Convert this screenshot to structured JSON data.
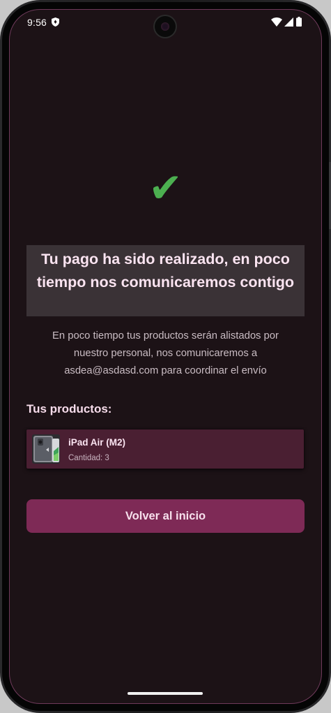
{
  "status_bar": {
    "time": "9:56",
    "icons": [
      "shield-icon",
      "wifi-icon",
      "signal-icon",
      "battery-icon"
    ]
  },
  "confirmation": {
    "check_symbol": "✔",
    "check_color": "#4caf50",
    "headline": "Tu pago ha sido realizado, en poco tiempo nos comunicaremos contigo",
    "description": "En poco tiempo tus productos serán alistados por nuestro personal, nos comunicaremos a asdea@asdasd.com para coordinar el envío"
  },
  "products": {
    "title": "Tus productos:",
    "items": [
      {
        "name": "iPad Air (M2)",
        "quantity_label": "Cantidad: 3"
      }
    ]
  },
  "actions": {
    "back_label": "Volver al inicio"
  },
  "colors": {
    "background": "#1c1216",
    "accent": "#7e2a56",
    "card": "#4a1f32",
    "headline_box": "#3a3236"
  }
}
